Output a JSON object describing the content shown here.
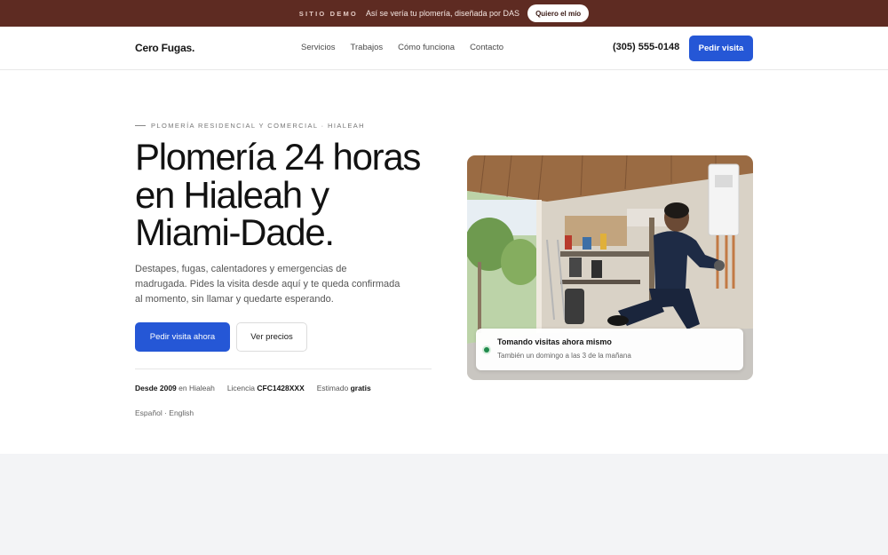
{
  "banner": {
    "tag": "SITIO DEMO",
    "text": "Así se vería tu plomería, diseñada por DAS",
    "button": "Quiero el mío"
  },
  "nav": {
    "logo": "Cero Fugas.",
    "links": [
      "Servicios",
      "Trabajos",
      "Cómo funciona",
      "Contacto"
    ],
    "phone": "(305) 555-0148",
    "cta": "Pedir visita"
  },
  "hero": {
    "eyebrow": "PLOMERÍA RESIDENCIAL Y COMERCIAL · HIALEAH",
    "headline": "Plomería 24 horas en Hialeah y Miami-Dade.",
    "subtext": "Destapes, fugas, calentadores y emergencias de madrugada. Pides la visita desde aquí y te queda confirmada al momento, sin llamar y quedarte esperando.",
    "primary_button": "Pedir visita ahora",
    "secondary_button": "Ver precios",
    "facts": {
      "since_strong": "Desde 2009",
      "since_rest": " en Hialeah",
      "license_label": "Licencia ",
      "license_strong": "CFC1428XXX",
      "estimate_label": "Estimado ",
      "estimate_strong": "gratis"
    },
    "languages": "Español · English"
  },
  "status_card": {
    "title": "Tomando visitas ahora mismo",
    "subtitle": "También un domingo a las 3 de la mañana",
    "dot_color": "#1f8a4c"
  },
  "colors": {
    "accent": "#2557d6",
    "banner": "#5e2b22"
  }
}
